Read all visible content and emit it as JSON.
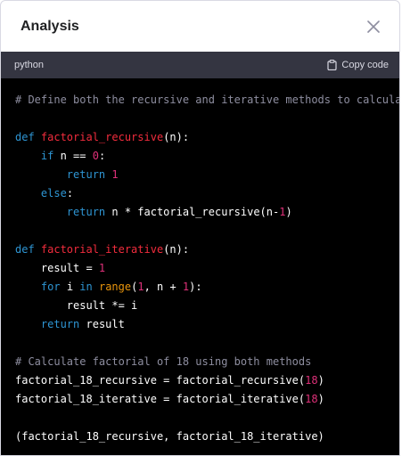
{
  "dialog": {
    "title": "Analysis",
    "close_icon": "close-icon"
  },
  "code_block": {
    "language": "python",
    "copy_label": "Copy code",
    "copy_icon": "clipboard-icon",
    "lines": [
      [
        {
          "t": "# Define both the recursive and iterative methods to calculate factorial",
          "c": "comment"
        }
      ],
      [],
      [
        {
          "t": "def ",
          "c": "kw"
        },
        {
          "t": "factorial_recursive",
          "c": "fn"
        },
        {
          "t": "(n):",
          "c": "plain"
        }
      ],
      [
        {
          "t": "    ",
          "c": "plain"
        },
        {
          "t": "if",
          "c": "kw"
        },
        {
          "t": " n == ",
          "c": "plain"
        },
        {
          "t": "0",
          "c": "num"
        },
        {
          "t": ":",
          "c": "plain"
        }
      ],
      [
        {
          "t": "        ",
          "c": "plain"
        },
        {
          "t": "return",
          "c": "kw"
        },
        {
          "t": " ",
          "c": "plain"
        },
        {
          "t": "1",
          "c": "num"
        }
      ],
      [
        {
          "t": "    ",
          "c": "plain"
        },
        {
          "t": "else",
          "c": "kw"
        },
        {
          "t": ":",
          "c": "plain"
        }
      ],
      [
        {
          "t": "        ",
          "c": "plain"
        },
        {
          "t": "return",
          "c": "kw"
        },
        {
          "t": " n * factorial_recursive(n-",
          "c": "plain"
        },
        {
          "t": "1",
          "c": "num"
        },
        {
          "t": ")",
          "c": "plain"
        }
      ],
      [],
      [
        {
          "t": "def ",
          "c": "kw"
        },
        {
          "t": "factorial_iterative",
          "c": "fn"
        },
        {
          "t": "(n):",
          "c": "plain"
        }
      ],
      [
        {
          "t": "    result = ",
          "c": "plain"
        },
        {
          "t": "1",
          "c": "num"
        }
      ],
      [
        {
          "t": "    ",
          "c": "plain"
        },
        {
          "t": "for",
          "c": "kw"
        },
        {
          "t": " i ",
          "c": "plain"
        },
        {
          "t": "in",
          "c": "kw"
        },
        {
          "t": " ",
          "c": "plain"
        },
        {
          "t": "range",
          "c": "builtin"
        },
        {
          "t": "(",
          "c": "plain"
        },
        {
          "t": "1",
          "c": "num"
        },
        {
          "t": ", n + ",
          "c": "plain"
        },
        {
          "t": "1",
          "c": "num"
        },
        {
          "t": "):",
          "c": "plain"
        }
      ],
      [
        {
          "t": "        result *= i",
          "c": "plain"
        }
      ],
      [
        {
          "t": "    ",
          "c": "plain"
        },
        {
          "t": "return",
          "c": "kw"
        },
        {
          "t": " result",
          "c": "plain"
        }
      ],
      [],
      [
        {
          "t": "# Calculate factorial of 18 using both methods",
          "c": "comment"
        }
      ],
      [
        {
          "t": "factorial_18_recursive = factorial_recursive(",
          "c": "plain"
        },
        {
          "t": "18",
          "c": "num"
        },
        {
          "t": ")",
          "c": "plain"
        }
      ],
      [
        {
          "t": "factorial_18_iterative = factorial_iterative(",
          "c": "plain"
        },
        {
          "t": "18",
          "c": "num"
        },
        {
          "t": ")",
          "c": "plain"
        }
      ],
      [],
      [
        {
          "t": "(factorial_18_recursive, factorial_18_iterative)",
          "c": "plain"
        }
      ]
    ]
  },
  "colors": {
    "keyword": "#2e95d3",
    "function_name": "#f22c3d",
    "number": "#df3079",
    "builtin": "#e9950c",
    "comment": "#8e8ea0",
    "code_background": "#000000",
    "code_header_background": "#343541"
  }
}
